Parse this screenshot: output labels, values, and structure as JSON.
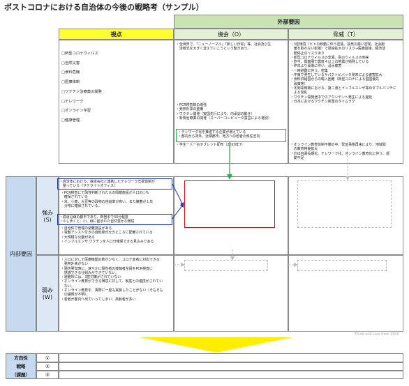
{
  "title": "ポストコロナにおける自治体の今後の戦略考（サンプル）",
  "external_header": "外部要因",
  "viewpoint_header": "視点",
  "opportunity_header": "機会（O）",
  "threat_header": "脅威（T）",
  "viewpoints": [
    "□新型コロナウィルス",
    "□自然災害",
    "□食料危機",
    "□医療体制",
    "□ワクチン治療薬の開発",
    "□テレワーク",
    "□オンライン学習",
    "□健康管理"
  ],
  "opportunities_top": [
    "・全世界で、「ニューノーマル」「新しい日常」等、社会及び生",
    "　活様式を大きく変えていこうという動きあり。"
  ],
  "opportunities_mid": [
    "・PCR検査数の増強",
    "・発熱外来の整備",
    "・ワクチン開発（実国先行により、内承認の動き）",
    "・新規治療薬の開発（スーパーコンピュータ富岳による選別）"
  ],
  "opportunities_box": [
    "・テレワーク化を推進する企業が増えている",
    "・都内から郊外、近隣都市、地方への若者の移住志向"
  ],
  "opportunities_bottom": [
    "・学生一人一台タブレット配布（2020年7）"
  ],
  "threats_top": [
    "・3密環境（ヒトの移動に伴う密集、換気の悪い密閉、社会距",
    "　離を取れない密接）で感染拡大のリスク→医療崩壊、経済活",
    "　動停止のリスクあり",
    "・新型コロナウィルスの変異、別のウィルスの到来",
    "・昨今、関東圏で震度４以上の地震が頻発している",
    "・昨年より豪雨に伴い、浸水被害",
    "・一時避難に伴う、密集",
    "・中東で発生しているサバクトビバッタ発来による被害拡大",
    "・食料供給国からの輸入困難（新型コロナによる国国優先",
    "　政策等）",
    "・冬到来時期における、第二波とインフルエンザ等のダブルパンチに",
    "　よる混乱",
    "・ワクチン開発途中でのアクシデント発生による遅延",
    "・日本におけるワクチン新薬のタイムラグ"
  ],
  "threats_bottom": [
    "・オンライン教育体制不備の中、緊急事態再来により、地域間",
    "　の教育格差拡大",
    "・外出自粛長期化、テレワーク化、オンライン教育化に伴う、運",
    "　動不足"
  ],
  "internal_label": "内部要因",
  "strength_label": "強み",
  "strength_letter": "(S)",
  "weakness_label": "弱み",
  "weakness_letter": "(W)",
  "strengths_box1": [
    "・自治体における、鉄道会社と連携したテレワーク支援体制が",
    "　整っている（サテライトオフィス）"
  ],
  "strengths_mid": [
    "・PCR検査にて陽性判断された大の隔離施設が人口の○%",
    "　確保されている",
    "・米、小麦、大豆等の穀物の自給率が高い、また備蓄が１年",
    "　分常に確保されている。"
  ],
  "strengths_box2": [
    "・鉄道沿線の都市であり、新宿まで30分程度",
    "・少し歩くと、川、緑に囲まれた自然豊かな環境"
  ],
  "strengths_bottom": [
    "・自治体で管理の避難施設がある",
    "・電動アシスト付きの自転車が大きところに配備されている",
    "・大規模な公園がある",
    "・インフルエンザ ワクチンを人口分確保できる見込みである"
  ],
  "weaknesses": [
    "・人口に対して医療機関の数が少なく、コロナ患者に対応できる",
    "　発熱外来がない",
    "・陽性発覚時に、速やかに陽性者の接触者全員をPCR検査に",
    "　誘導できる仕組みができていない。",
    "・避難所には、3密対策がされていない",
    "・オンライン教育ができる環境に対して、家庭との連携がされてい",
    "　ない。",
    "・オンライン教育を、実際に一度も実施したことがない（そもそも",
    "　の課題が不明）。",
    "・若者が都内へ出ていってしまい、高齢者が多い"
  ],
  "direction_label_1": "方向性",
  "direction_label_2": "戦略",
  "direction_label_3": "（課題）",
  "circled": [
    "①",
    "②",
    "③"
  ],
  "watermark": "Think and Live from 2020",
  "colors": {
    "green_header": "#c9e3b4",
    "yellow_header": "#ffff33",
    "blue_side": "#c6d9ee",
    "red_box": "#e01010",
    "blue_box": "#1f3aa0",
    "green_box": "#2fae4a",
    "arrow_yellow": "#ffee00"
  }
}
